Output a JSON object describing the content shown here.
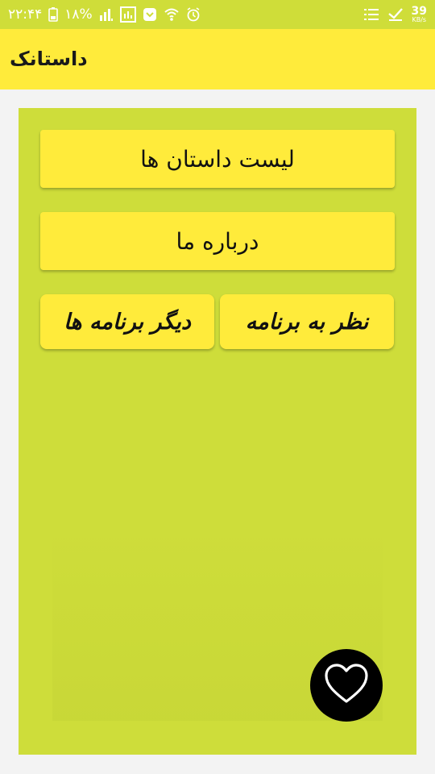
{
  "status_bar": {
    "time": "۲۲:۴۴",
    "battery": "۱۸%",
    "net_speed_value": "39",
    "net_speed_unit": "KB/s"
  },
  "app_bar": {
    "title": "داستانک"
  },
  "menu": {
    "stories_label": "لیست داستان ها",
    "about_label": "درباره ما",
    "rate_label": "نظر به برنامه",
    "other_apps_label": "دیگر برنامه ها"
  },
  "colors": {
    "status_bar_bg": "#cfdd39",
    "app_bar_bg": "#ffeb3b",
    "panel_bg": "#cedd3a",
    "button_bg": "#ffeb3b",
    "fab_bg": "#000000"
  },
  "icons": {
    "status_left": [
      "battery-icon",
      "signal-icon",
      "app-notification-icon",
      "messenger-icon",
      "wifi-icon",
      "alarm-icon"
    ],
    "status_right": [
      "list-icon",
      "checkmark-icon"
    ],
    "fab": "heart-icon"
  }
}
